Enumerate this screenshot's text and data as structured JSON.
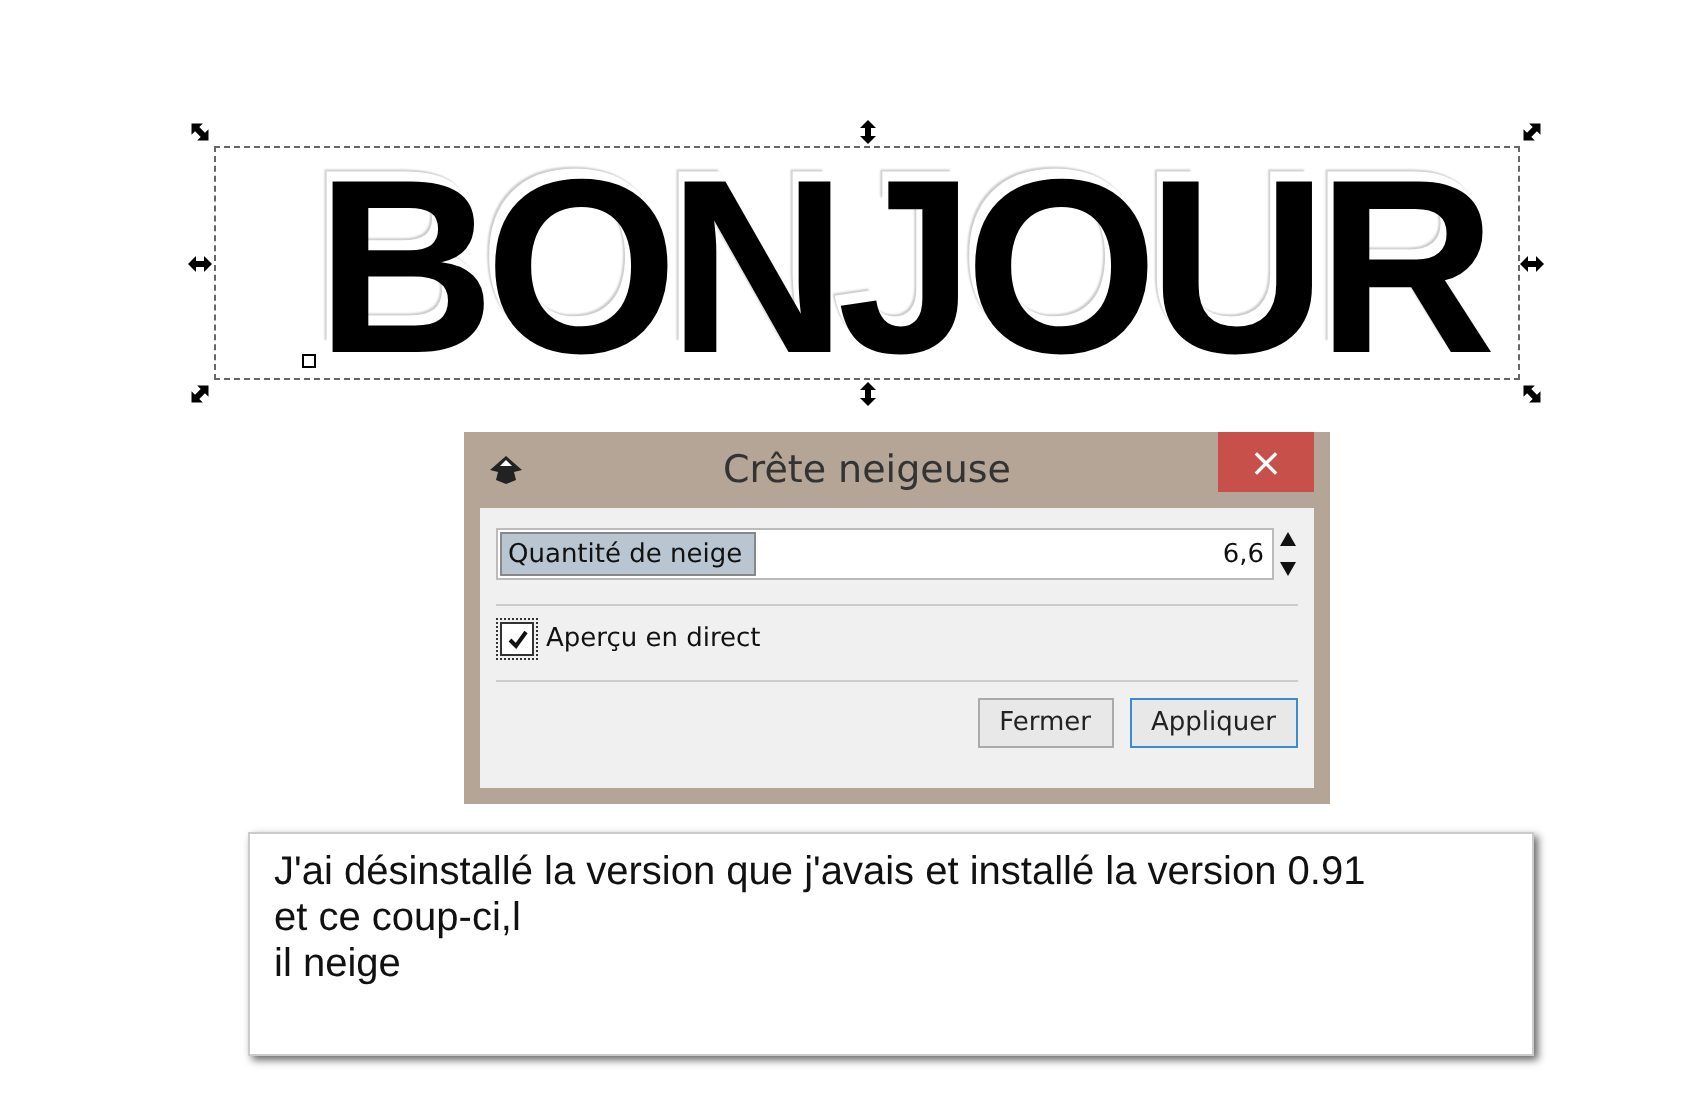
{
  "canvas": {
    "text": "BONJOUR"
  },
  "dialog": {
    "title": "Crête neigeuse",
    "close": "×",
    "slider": {
      "label": "Quantité de neige",
      "level": 0.33,
      "value": "6,6"
    },
    "checkbox": {
      "label": "Aperçu en direct",
      "checked": true
    },
    "buttons": [
      {
        "label": "Fermer",
        "default": false
      },
      {
        "label": "Appliquer",
        "default": true
      }
    ]
  },
  "note": {
    "text": "J'ai désinstallé la version que j'avais et installé la version 0.91\net ce coup-ci,l\nil neige"
  }
}
